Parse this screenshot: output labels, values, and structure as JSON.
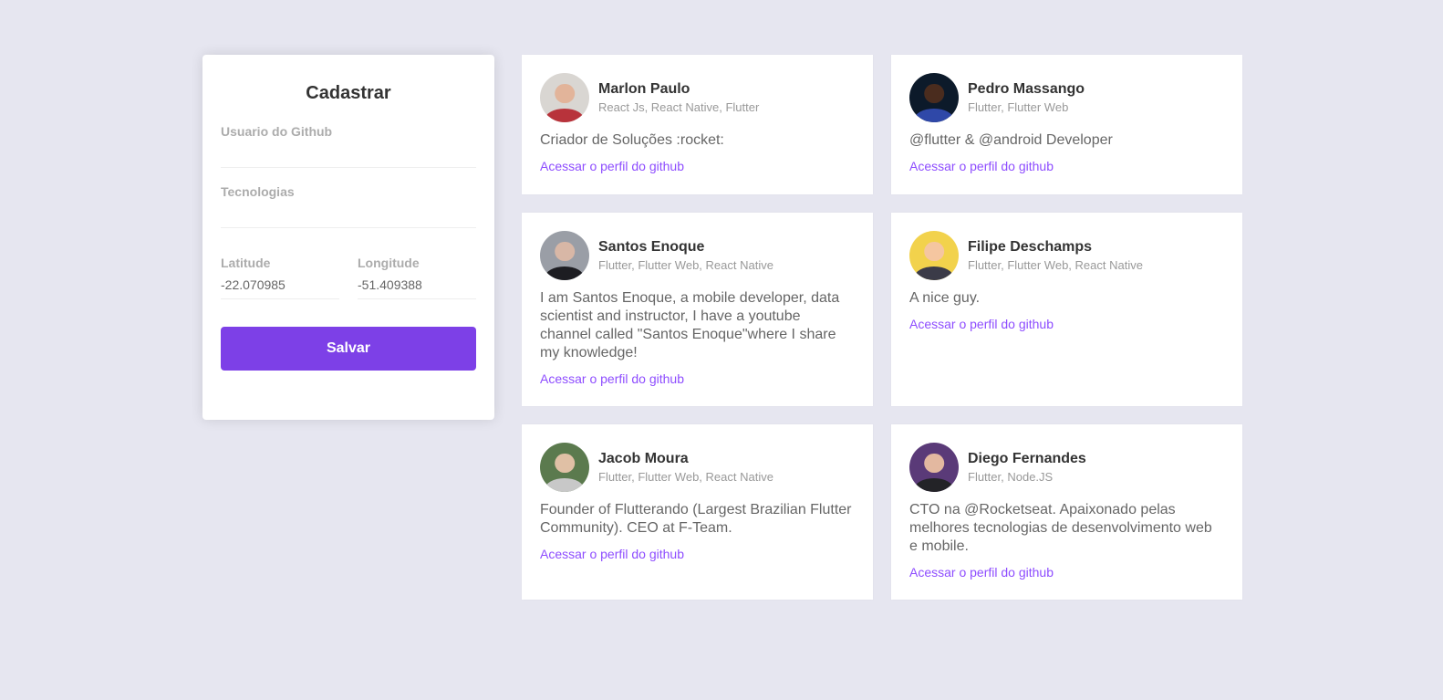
{
  "form": {
    "title": "Cadastrar",
    "github_user": {
      "label": "Usuario do Github",
      "value": ""
    },
    "techs": {
      "label": "Tecnologias",
      "value": ""
    },
    "latitude": {
      "label": "Latitude",
      "value": "-22.070985"
    },
    "longitude": {
      "label": "Longitude",
      "value": "-51.409388"
    },
    "save_label": "Salvar"
  },
  "colors": {
    "background": "#e6e6f0",
    "accent": "#7d40e7",
    "link": "#8e4dff"
  },
  "devs": [
    {
      "name": "Marlon Paulo",
      "techs": "React Js, React Native, Flutter",
      "bio": "Criador de Soluções :rocket:",
      "link": "Acessar o perfil do github",
      "avatar": {
        "bg": "#d9d6d2",
        "face": "#e2b49a",
        "body": "#b8333b"
      }
    },
    {
      "name": "Pedro Massango",
      "techs": "Flutter, Flutter Web",
      "bio": "@flutter & @android Developer",
      "link": "Acessar o perfil do github",
      "avatar": {
        "bg": "#0c1a2a",
        "face": "#4a2c1e",
        "body": "#2f48a8"
      }
    },
    {
      "name": "Santos Enoque",
      "techs": "Flutter, Flutter Web, React Native",
      "bio": "I am Santos Enoque, a mobile developer, data scientist and instructor, I have a youtube channel called \"Santos Enoque\"where I share my knowledge!",
      "link": "Acessar o perfil do github",
      "avatar": {
        "bg": "#9a9ea6",
        "face": "#d8b7a6",
        "body": "#1d1d22"
      }
    },
    {
      "name": "Filipe Deschamps",
      "techs": "Flutter, Flutter Web, React Native",
      "bio": "A nice guy.",
      "link": "Acessar o perfil do github",
      "avatar": {
        "bg": "#f2d24c",
        "face": "#f5c6a0",
        "body": "#3b3b48"
      }
    },
    {
      "name": "Jacob Moura",
      "techs": "Flutter, Flutter Web, React Native",
      "bio": "Founder of Flutterando (Largest Brazilian Flutter Community). CEO at F-Team.",
      "link": "Acessar o perfil do github",
      "avatar": {
        "bg": "#5b7a4e",
        "face": "#e0c0a5",
        "body": "#c8c8c8"
      }
    },
    {
      "name": "Diego Fernandes",
      "techs": "Flutter, Node.JS",
      "bio": "CTO na @Rocketseat. Apaixonado pelas melhores tecnologias de desenvolvimento web e mobile.",
      "link": "Acessar o perfil do github",
      "avatar": {
        "bg": "#5a3a78",
        "face": "#e3b8a0",
        "body": "#232327"
      }
    }
  ]
}
